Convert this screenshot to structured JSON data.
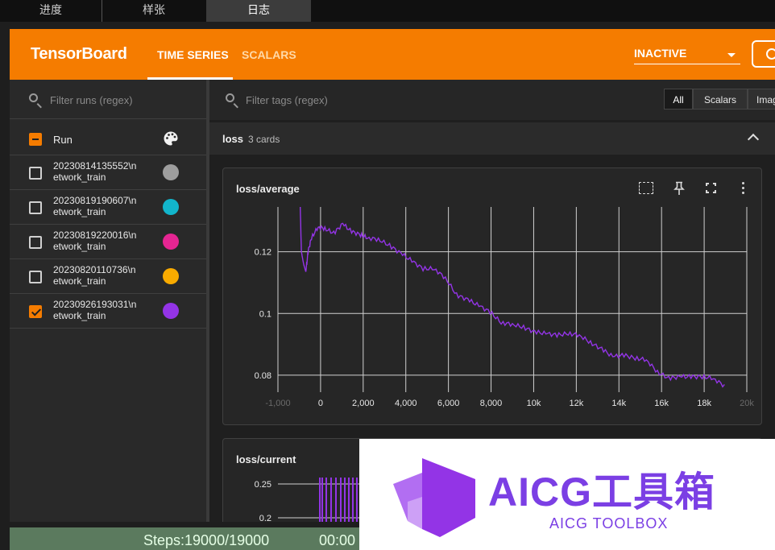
{
  "top_tabs": [
    {
      "label": "进度",
      "active": false
    },
    {
      "label": "样张",
      "active": false
    },
    {
      "label": "日志",
      "active": true
    }
  ],
  "header": {
    "brand": "TensorBoard",
    "tabs": [
      {
        "label": "TIME SERIES",
        "active": true
      },
      {
        "label": "SCALARS",
        "active": false
      }
    ],
    "run_state": "INACTIVE",
    "settings_icon": "settings-icon"
  },
  "sidebar": {
    "filter_placeholder": "Filter runs (regex)",
    "run_header": "Run",
    "palette_icon": "palette-icon",
    "runs": [
      {
        "name": "20230814135552\\network_train",
        "checked": false,
        "color": "#9e9e9e"
      },
      {
        "name": "20230819190607\\network_train",
        "checked": false,
        "color": "#12b5cb"
      },
      {
        "name": "20230819220016\\network_train",
        "checked": false,
        "color": "#e52592"
      },
      {
        "name": "20230820110736\\network_train",
        "checked": false,
        "color": "#f9ab00"
      },
      {
        "name": "20230926193031\\network_train",
        "checked": true,
        "color": "#9334e6"
      }
    ]
  },
  "main": {
    "filter_placeholder": "Filter tags (regex)",
    "type_buttons": [
      {
        "label": "All",
        "active": true
      },
      {
        "label": "Scalars",
        "active": false
      },
      {
        "label": "Image",
        "active": false
      }
    ],
    "group": {
      "name": "loss",
      "count": "3 cards"
    },
    "cards": [
      {
        "title": "loss/average"
      },
      {
        "title": "loss/current"
      }
    ]
  },
  "status": {
    "steps": "Steps:19000/19000",
    "time": "00:00"
  },
  "watermark": {
    "title": "AICG工具箱",
    "subtitle": "AICG TOOLBOX"
  },
  "colors": {
    "accent": "#f57c00",
    "series": "#9334e6"
  },
  "chart_data": [
    {
      "type": "line",
      "title": "loss/average",
      "xlim": [
        -1000,
        20000
      ],
      "ylim": [
        0.0745,
        0.1345
      ],
      "x_ticks": [
        "-1,000",
        "0",
        "2,000",
        "4,000",
        "6,000",
        "8,000",
        "10k",
        "12k",
        "14k",
        "16k",
        "18k",
        "20k"
      ],
      "y_ticks": [
        0.08,
        0.1,
        0.12
      ],
      "y_tick_labels": [
        "0.08",
        "0.1",
        "0.12"
      ],
      "grid": true,
      "series": [
        {
          "x": [
            0,
            50,
            150,
            250,
            350,
            500,
            800,
            1100,
            1500,
            1900,
            2300,
            2700,
            3000,
            3500,
            4000,
            4500,
            5000,
            5500,
            6000,
            6500,
            7000,
            7500,
            8000,
            8500,
            9000,
            9500,
            10000,
            10500,
            11000,
            11500,
            12000,
            12500,
            13000,
            13500,
            14000,
            14500,
            15000,
            15500,
            16000,
            16500,
            17000,
            17500,
            18000,
            18500,
            19000
          ],
          "y": [
            0.1345,
            0.12,
            0.116,
            0.1135,
            0.12,
            0.1245,
            0.128,
            0.1275,
            0.126,
            0.129,
            0.1265,
            0.1255,
            0.1245,
            0.124,
            0.122,
            0.1195,
            0.117,
            0.1145,
            0.1145,
            0.1115,
            0.106,
            0.1045,
            0.1025,
            0.1005,
            0.097,
            0.0965,
            0.0955,
            0.094,
            0.0935,
            0.093,
            0.0935,
            0.093,
            0.0905,
            0.0885,
            0.086,
            0.0865,
            0.0855,
            0.085,
            0.081,
            0.079,
            0.0795,
            0.0795,
            0.0795,
            0.079,
            0.0765
          ]
        }
      ]
    },
    {
      "type": "line",
      "title": "loss/current",
      "y_ticks": [
        0.2,
        0.25
      ],
      "y_tick_labels": [
        "0.2",
        "0.25"
      ],
      "grid": true
    }
  ]
}
